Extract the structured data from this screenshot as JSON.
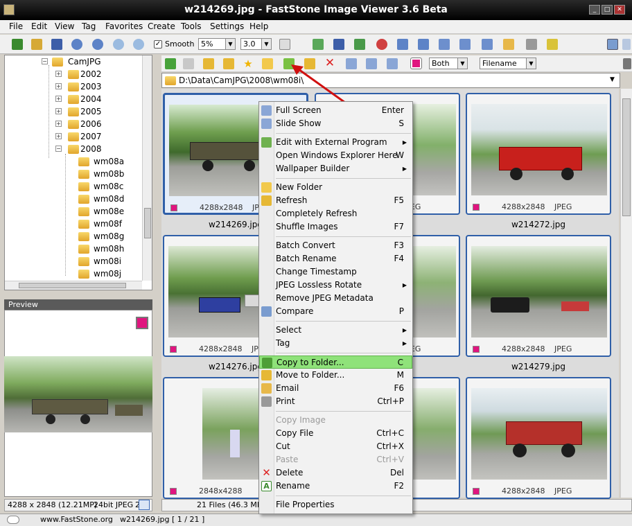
{
  "window": {
    "title": "w214269.jpg  -  FastStone Image Viewer 3.6 Beta"
  },
  "menubar": [
    "File",
    "Edit",
    "View",
    "Tag",
    "Favorites",
    "Create",
    "Tools",
    "Settings",
    "Help"
  ],
  "toolbar": {
    "smooth_label": "Smooth",
    "zoom_value": "5%",
    "ratio_value": "3.0"
  },
  "tree": {
    "root": "CamJPG",
    "years": [
      "2002",
      "2003",
      "2004",
      "2005",
      "2006",
      "2007",
      "2008"
    ],
    "subfolders": [
      "wm08a",
      "wm08b",
      "wm08c",
      "wm08d",
      "wm08e",
      "wm08f",
      "wm08g",
      "wm08h",
      "wm08i",
      "wm08j"
    ]
  },
  "preview": {
    "header": "Preview",
    "status_dims": "4288 x 2848 (12.21MP)",
    "status_bits": "24bit JPEG",
    "status_extra": "2"
  },
  "browser": {
    "filter_value": "Both",
    "sort_value": "Filename",
    "path": "D:\\Data\\CamJPG\\2008\\wm08i\\"
  },
  "thumbs": [
    {
      "dims": "4288x2848",
      "fmt": "JPEG",
      "name": "w214269.jpg"
    },
    {
      "dims": "",
      "fmt": "JPEG",
      "name": ""
    },
    {
      "dims": "4288x2848",
      "fmt": "JPEG",
      "name": "w214272.jpg"
    },
    {
      "dims": "4288x2848",
      "fmt": "JPEG",
      "name": "w214276.jpg"
    },
    {
      "dims": "",
      "fmt": "JPEG",
      "name": ""
    },
    {
      "dims": "4288x2848",
      "fmt": "JPEG",
      "name": "w214279.jpg"
    },
    {
      "dims": "2848x4288",
      "fmt": "",
      "name": ""
    },
    {
      "dims": "",
      "fmt": "",
      "name": ""
    },
    {
      "dims": "4288x2848",
      "fmt": "JPEG",
      "name": ""
    }
  ],
  "files_status": "21 Files (46.3 MB)",
  "bottombar": {
    "site": "www.FastStone.org",
    "file": "w214269.jpg [ 1 / 21 ]"
  },
  "context_menu": {
    "items": [
      {
        "label": "Full Screen",
        "shortcut": "Enter",
        "icon": "fullscreen-icon"
      },
      {
        "label": "Slide Show",
        "shortcut": "S",
        "icon": "slideshow-icon"
      },
      {
        "label": "Edit with External Program",
        "shortcut": "",
        "submenu": true,
        "icon": "palette-icon"
      },
      {
        "label": "Open Windows Explorer Here",
        "shortcut": "W"
      },
      {
        "label": "Wallpaper Builder",
        "shortcut": "",
        "submenu": true
      },
      {
        "label": "New Folder",
        "shortcut": "",
        "icon": "new-folder-icon"
      },
      {
        "label": "Refresh",
        "shortcut": "F5",
        "icon": "refresh-icon"
      },
      {
        "label": "Completely Refresh",
        "shortcut": ""
      },
      {
        "label": "Shuffle Images",
        "shortcut": "F7"
      },
      {
        "label": "Batch Convert",
        "shortcut": "F3"
      },
      {
        "label": "Batch Rename",
        "shortcut": "F4"
      },
      {
        "label": "Change Timestamp",
        "shortcut": ""
      },
      {
        "label": "JPEG Lossless Rotate",
        "shortcut": "",
        "submenu": true
      },
      {
        "label": "Remove JPEG Metadata",
        "shortcut": ""
      },
      {
        "label": "Compare",
        "shortcut": "P",
        "icon": "compare-icon"
      },
      {
        "label": "Select",
        "shortcut": "",
        "submenu": true
      },
      {
        "label": "Tag",
        "shortcut": "",
        "submenu": true
      },
      {
        "label": "Copy to Folder...",
        "shortcut": "C",
        "icon": "copy-to-folder-icon",
        "highlighted": true
      },
      {
        "label": "Move to Folder...",
        "shortcut": "M",
        "icon": "move-to-folder-icon"
      },
      {
        "label": "Email",
        "shortcut": "F6",
        "icon": "email-icon"
      },
      {
        "label": "Print",
        "shortcut": "Ctrl+P",
        "icon": "print-icon"
      },
      {
        "label": "Copy Image",
        "shortcut": "",
        "disabled": true
      },
      {
        "label": "Copy File",
        "shortcut": "Ctrl+C"
      },
      {
        "label": "Cut",
        "shortcut": "Ctrl+X"
      },
      {
        "label": "Paste",
        "shortcut": "Ctrl+V",
        "disabled": true
      },
      {
        "label": "Delete",
        "shortcut": "Del",
        "icon": "delete-icon"
      },
      {
        "label": "Rename",
        "shortcut": "F2",
        "icon": "rename-icon"
      },
      {
        "label": "File Properties",
        "shortcut": ""
      }
    ]
  },
  "colors": {
    "accent": "#2f5fa8",
    "highlight": "#8fe27a",
    "tag": "#e0157f",
    "arrow": "#d01010"
  }
}
